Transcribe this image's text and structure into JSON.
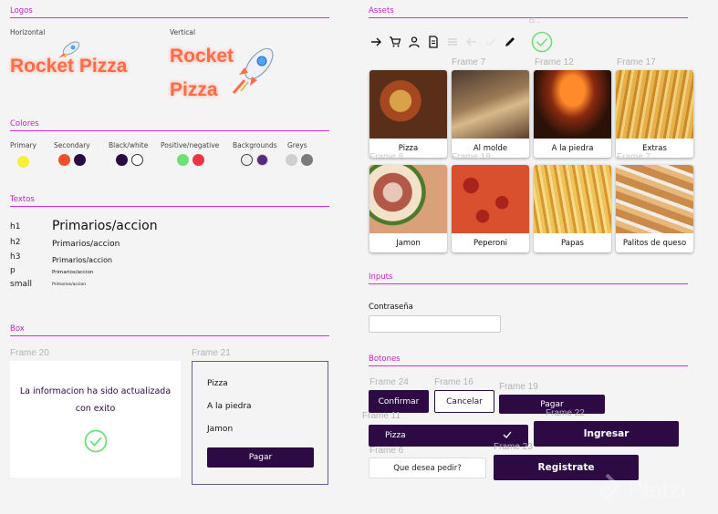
{
  "left": {
    "logos": {
      "title": "Logos",
      "horizontal_label": "Horizontal",
      "vertical_label": "Vertical",
      "logo_word1": "Rocket",
      "logo_word2": "Pizza",
      "logo_horizontal_text": "Rocket Pizza"
    },
    "colors": {
      "title": "Colores",
      "groups": [
        {
          "label": "Primary",
          "swatches": [
            "#f5f03a"
          ]
        },
        {
          "label": "Secondary",
          "swatches": [
            "#f0512a",
            "#2a0a45"
          ]
        },
        {
          "label": "Black/white",
          "swatches": [
            "#2a0a45",
            "#ffffff"
          ]
        },
        {
          "label": "Positive/negative",
          "swatches": [
            "#6ee07a",
            "#ef3340"
          ]
        },
        {
          "label": "Backgrounds",
          "swatches": [
            "#eeeeee",
            "#5a2a78"
          ]
        },
        {
          "label": "Greys",
          "swatches": [
            "#cfcfcf",
            "#7b7b7b"
          ]
        }
      ]
    },
    "texts": {
      "title": "Textos",
      "rows": [
        {
          "tag": "h1",
          "sample": "Primarios/accion"
        },
        {
          "tag": "h2",
          "sample": "Primarios/accion"
        },
        {
          "tag": "h3",
          "sample": "Primarios/accion"
        },
        {
          "tag": "p",
          "sample": "Primarios/accion"
        },
        {
          "tag": "small",
          "sample": "Primarios/accion"
        }
      ]
    },
    "box": {
      "title": "Box",
      "frame20_label": "Frame 20",
      "frame21_label": "Frame 21",
      "success_message": "La informacion ha sido actualizada con exito",
      "order_items": [
        "Pizza",
        "A la piedra",
        "Jamon"
      ],
      "pay_label": "Pagar"
    }
  },
  "right": {
    "assets": {
      "title": "Assets",
      "ghost_label": "cl...",
      "icons": [
        "arrow-right",
        "cart",
        "user",
        "document",
        "menu",
        "arrow-left",
        "check",
        "pencil"
      ],
      "cards": [
        {
          "frame": "",
          "caption": "Pizza",
          "color": "#8a4a2a"
        },
        {
          "frame": "Frame 7",
          "caption": "Al molde",
          "color": "#6b5140"
        },
        {
          "frame": "Frame 12",
          "caption": "A la piedra",
          "color": "#b04a1d"
        },
        {
          "frame": "Frame 17",
          "caption": "Extras",
          "color": "#d9a042"
        },
        {
          "frame": "Frame 8",
          "caption": "Jamon",
          "color": "#c98a7a"
        },
        {
          "frame": "Frame 18",
          "caption": "Peperoni",
          "color": "#b8301e"
        },
        {
          "frame": "",
          "caption": "Papas",
          "color": "#d99a3a"
        },
        {
          "frame": "Frame 7",
          "caption": "Palitos de queso",
          "color": "#cfa070"
        }
      ]
    },
    "inputs": {
      "title": "Inputs",
      "password_label": "Contraseña",
      "password_value": ""
    },
    "buttons": {
      "title": "Botones",
      "frame24": "Frame 24",
      "frame16": "Frame 16",
      "frame19": "Frame 19",
      "frame11": "Frame 11",
      "frame22": "Frame 22",
      "frame6": "Frame 6",
      "frame23": "Frame 23",
      "confirm": "Confirmar",
      "cancel": "Cancelar",
      "pay": "Pagar",
      "select_value": "Pizza",
      "login": "Ingresar",
      "order_prompt": "Que desea pedir?",
      "register": "Registrate"
    }
  },
  "watermark": "Platzi"
}
